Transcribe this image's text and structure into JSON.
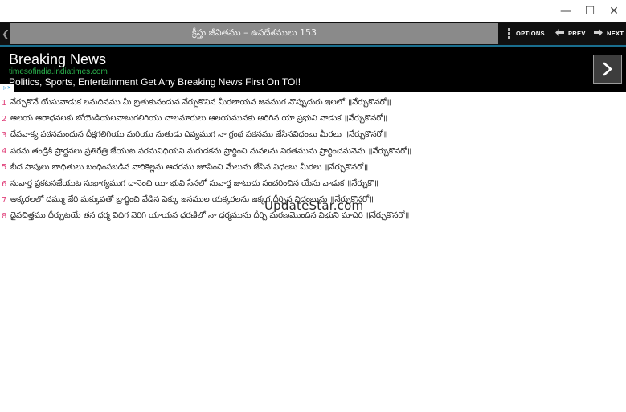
{
  "window": {
    "minimize_glyph": "—",
    "maximize_glyph": "☐",
    "close_glyph": "✕"
  },
  "toolbar": {
    "back_glyph": "❮",
    "title": "క్రీస్తు జీవితము – ఉపదేశములు 153",
    "options_label": "OPTIONS",
    "prev_label": "PREV",
    "next_label": "NEXT",
    "accent_color": "#1a6f8f"
  },
  "ad": {
    "title": "Breaking News",
    "url": "timesofindia.indiatimes.com",
    "description": "Politics, Sports, Entertainment Get Any Breaking News First On TOI!",
    "choice_label": "▷✕",
    "arrow_icon": "chevron-right-icon"
  },
  "verses": [
    {
      "num": "1",
      "text": "నేర్చుకొనే యేసువాడుక లనుదినము మీ బ్రతుకునందున నేర్చుకొనిన మీరలాయన జనముగ నొప్పుదురు ఇలలో ॥నేర్చుకొనరో॥"
    },
    {
      "num": "2",
      "text": "ఆలయ ఆరాధనలకు బోయెడియలవాటుగలిగియు చాలమారులు ఆలయమునకు అరిగిన యా ప్రభుని వాడుక ॥నేర్చుకొనరో॥"
    },
    {
      "num": "3",
      "text": "దేవవాక్య పఠనమందున దీక్షగలిగియు మరియు నుతుడు దివ్యముగ నా గ్రంథ పఠనము జేసినవిధంబు మీరలు ॥నేర్చుకొనరో॥"
    },
    {
      "num": "4",
      "text": "పరమ తండ్రికి ప్రార్థనలు ప్రతిరేత్రి జేయుట పరమవిధియని మరుదకను ప్రార్థించి మనలను నిరతమును ప్రార్థించమనెను ॥నేర్చుకొనరో॥"
    },
    {
      "num": "5",
      "text": "బీద పాపులు బాధితులు బంధింపబడిన వారికెల్లను ఆదరము జూపించి మేలును జేసిన విధంబు మీరలు ॥నేర్చుకొనరో॥"
    },
    {
      "num": "6",
      "text": "సువార్త ప్రకటనజేయుట సుభాగ్యముగ దానెంచి యీ భువి సేనలో సువార్త జాటుచు సంచరించిన యేసు వాడుక ॥నేర్చుకొ॥"
    },
    {
      "num": "7",
      "text": "అక్కరలలో దమ్ము జేరి మక్కువతో బ్రార్థించి వేడిన పెక్కు జనముల యక్కరలను జక్కగ దీర్చిన విధంబును ॥నేర్చుకొనరో॥"
    },
    {
      "num": "8",
      "text": "దైవచిత్తము దీర్చుటయే తన ధర్మ విధిగ నెరిగి యాయన ధరణిలో నా ధర్మమును దీర్చి మరణమొందిన విభుని మాదిరి ॥నేర్చుకొనరో॥"
    }
  ],
  "watermark": "UpdateStar.com"
}
